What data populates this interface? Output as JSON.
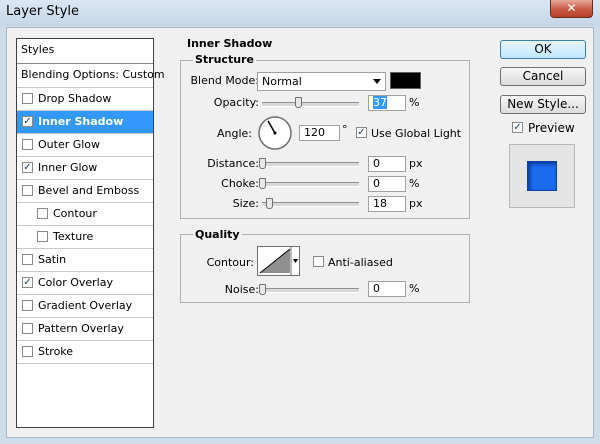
{
  "window": {
    "title": "Layer Style",
    "close_glyph": "✕"
  },
  "styles_panel": {
    "header": "Styles",
    "blending": "Blending Options: Custom",
    "items": [
      {
        "label": "Drop Shadow",
        "checked": false,
        "indent": false,
        "selected": false
      },
      {
        "label": "Inner Shadow",
        "checked": true,
        "indent": false,
        "selected": true
      },
      {
        "label": "Outer Glow",
        "checked": false,
        "indent": false,
        "selected": false
      },
      {
        "label": "Inner Glow",
        "checked": true,
        "indent": false,
        "selected": false
      },
      {
        "label": "Bevel and Emboss",
        "checked": false,
        "indent": false,
        "selected": false
      },
      {
        "label": "Contour",
        "checked": false,
        "indent": true,
        "selected": false
      },
      {
        "label": "Texture",
        "checked": false,
        "indent": true,
        "selected": false
      },
      {
        "label": "Satin",
        "checked": false,
        "indent": false,
        "selected": false
      },
      {
        "label": "Color Overlay",
        "checked": true,
        "indent": false,
        "selected": false
      },
      {
        "label": "Gradient Overlay",
        "checked": false,
        "indent": false,
        "selected": false
      },
      {
        "label": "Pattern Overlay",
        "checked": false,
        "indent": false,
        "selected": false
      },
      {
        "label": "Stroke",
        "checked": false,
        "indent": false,
        "selected": false
      }
    ]
  },
  "inner_shadow": {
    "section_title": "Inner Shadow",
    "structure": {
      "title": "Structure",
      "blend_mode_label": "Blend Mode:",
      "blend_mode_value": "Normal",
      "shadow_color": "#000000",
      "opacity_label": "Opacity:",
      "opacity_value": "37",
      "opacity_fraction": 0.37,
      "angle_label": "Angle:",
      "angle_value": "120",
      "angle_degrees": 120,
      "degree_symbol": "°",
      "use_global_light_label": "Use Global Light",
      "use_global_light_checked": true,
      "distance_label": "Distance:",
      "distance_value": "0",
      "distance_fraction": 0,
      "choke_label": "Choke:",
      "choke_value": "0",
      "choke_fraction": 0,
      "size_label": "Size:",
      "size_value": "18",
      "size_fraction": 0.07,
      "unit_percent": "%",
      "unit_px": "px"
    },
    "quality": {
      "title": "Quality",
      "contour_label": "Contour:",
      "anti_aliased_label": "Anti-aliased",
      "anti_aliased_checked": false,
      "noise_label": "Noise:",
      "noise_value": "0",
      "noise_fraction": 0
    }
  },
  "buttons": {
    "ok": "OK",
    "cancel": "Cancel",
    "new_style": "New Style...",
    "preview_label": "Preview",
    "preview_checked": true
  },
  "colors": {
    "selection": "#3399ff",
    "preview_fill": "#1d6cf0"
  }
}
